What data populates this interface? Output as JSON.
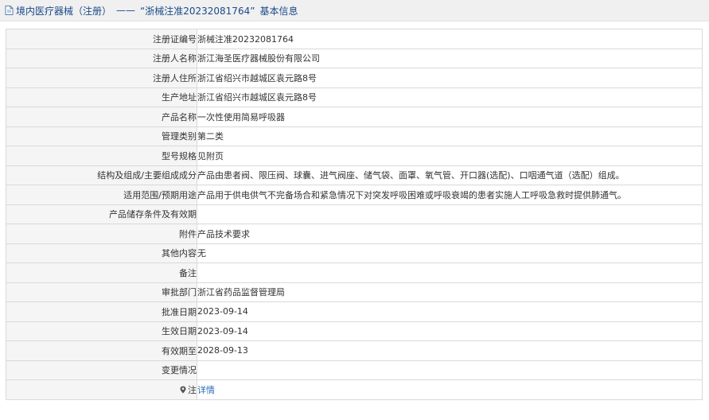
{
  "page": {
    "title_prefix": "境内医疗器械（注册）",
    "title_dash": "——",
    "title_reg_no": "“浙械注准20232081764”",
    "title_suffix": "基本信息"
  },
  "rows": [
    {
      "label": "注册证编号",
      "value": "浙械注准20232081764"
    },
    {
      "label": "注册人名称",
      "value": "浙江海圣医疗器械股份有限公司"
    },
    {
      "label": "注册人住所",
      "value": "浙江省绍兴市越城区袁元路8号"
    },
    {
      "label": "生产地址",
      "value": "浙江省绍兴市越城区袁元路8号"
    },
    {
      "label": "产品名称",
      "value": "一次性使用简易呼吸器"
    },
    {
      "label": "管理类别",
      "value": "第二类"
    },
    {
      "label": "型号规格",
      "value": "见附页"
    },
    {
      "label": "结构及组成/主要组成成分",
      "value": "产品由患者阀、限压阀、球囊、进气阀座、储气袋、面罩、氧气管、开口器(选配)、口咽通气道（选配）组成。"
    },
    {
      "label": "适用范围/预期用途",
      "value": "产品用于供电供气不完备场合和紧急情况下对突发呼吸困难或呼吸衰竭的患者实施人工呼吸急救时提供肺通气。"
    },
    {
      "label": "产品储存条件及有效期",
      "value": ""
    },
    {
      "label": "附件",
      "value": "产品技术要求"
    },
    {
      "label": "其他内容",
      "value": "无"
    },
    {
      "label": "备注",
      "value": ""
    },
    {
      "label": "审批部门",
      "value": "浙江省药品监督管理局"
    },
    {
      "label": "批准日期",
      "value": "2023-09-14"
    },
    {
      "label": "生效日期",
      "value": "2023-09-14"
    },
    {
      "label": "有效期至",
      "value": "2028-09-13"
    },
    {
      "label": "变更情况",
      "value": ""
    }
  ],
  "note_row": {
    "label": "注",
    "link_text": "详情",
    "icon": "location-pin-icon"
  },
  "colors": {
    "link": "#2f6bb5",
    "title": "#1a4a8a",
    "label_bg": "#f5f5f5",
    "border": "#d9d9d9"
  }
}
